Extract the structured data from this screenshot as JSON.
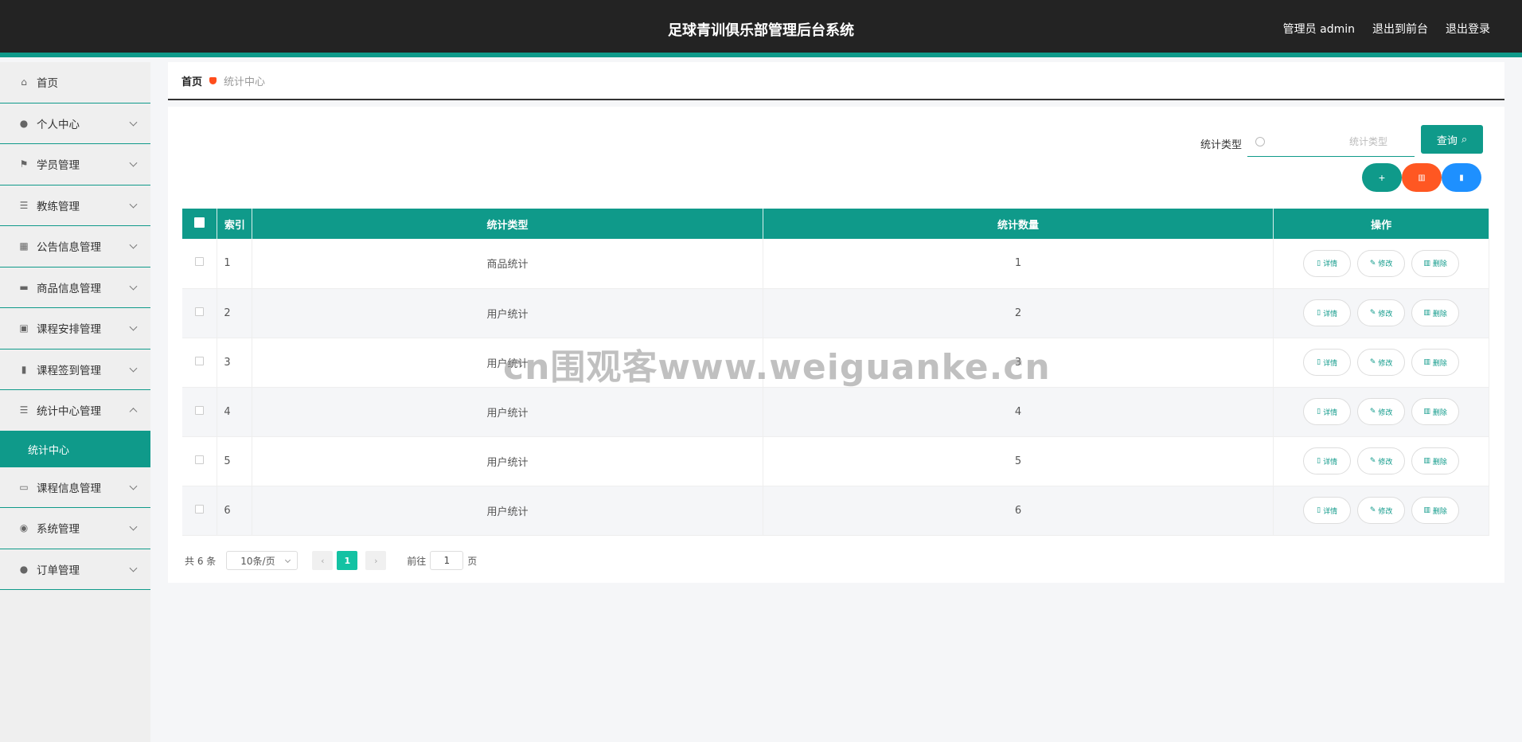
{
  "header": {
    "title": "足球青训俱乐部管理后台系统",
    "user": "管理员 admin",
    "to_front": "退出到前台",
    "logout": "退出登录"
  },
  "sidebar": {
    "items": [
      {
        "label": "首页",
        "icon": "home-icon"
      },
      {
        "label": "个人中心",
        "icon": "user-icon"
      },
      {
        "label": "学员管理",
        "icon": "flag-icon"
      },
      {
        "label": "教练管理",
        "icon": "list-icon"
      },
      {
        "label": "公告信息管理",
        "icon": "grid-icon"
      },
      {
        "label": "商品信息管理",
        "icon": "message-icon"
      },
      {
        "label": "课程安排管理",
        "icon": "clipboard-icon"
      },
      {
        "label": "课程签到管理",
        "icon": "bar-chart-icon"
      },
      {
        "label": "统计中心管理",
        "icon": "list-icon"
      },
      {
        "label": "课程信息管理",
        "icon": "monitor-icon"
      },
      {
        "label": "系统管理",
        "icon": "compass-icon"
      },
      {
        "label": "订单管理",
        "icon": "user-icon"
      }
    ],
    "submenu": "统计中心"
  },
  "breadcrumb": {
    "home": "首页",
    "current": "统计中心"
  },
  "search": {
    "label": "统计类型",
    "placeholder": "统计类型",
    "query_button": "查询"
  },
  "table": {
    "headers": [
      "索引",
      "统计类型",
      "统计数量",
      "操作"
    ],
    "rows": [
      {
        "index": "1",
        "type": "商品统计",
        "count": "1"
      },
      {
        "index": "2",
        "type": "用户统计",
        "count": "2"
      },
      {
        "index": "3",
        "type": "用户统计",
        "count": "3"
      },
      {
        "index": "4",
        "type": "用户统计",
        "count": "4"
      },
      {
        "index": "5",
        "type": "用户统计",
        "count": "5"
      },
      {
        "index": "6",
        "type": "用户统计",
        "count": "6"
      }
    ],
    "actions": {
      "detail": "详情",
      "edit": "修改",
      "delete": "删除"
    }
  },
  "pagination": {
    "total": "共 6 条",
    "page_size": "10条/页",
    "current_page": "1",
    "goto_prefix": "前往",
    "goto_value": "1",
    "goto_suffix": "页"
  },
  "watermark": "cn围观客www.weiguanke.cn",
  "colors": {
    "accent": "#0f9a8a",
    "danger": "#ff5722",
    "info": "#1e90ff",
    "header_bg": "#232323"
  }
}
